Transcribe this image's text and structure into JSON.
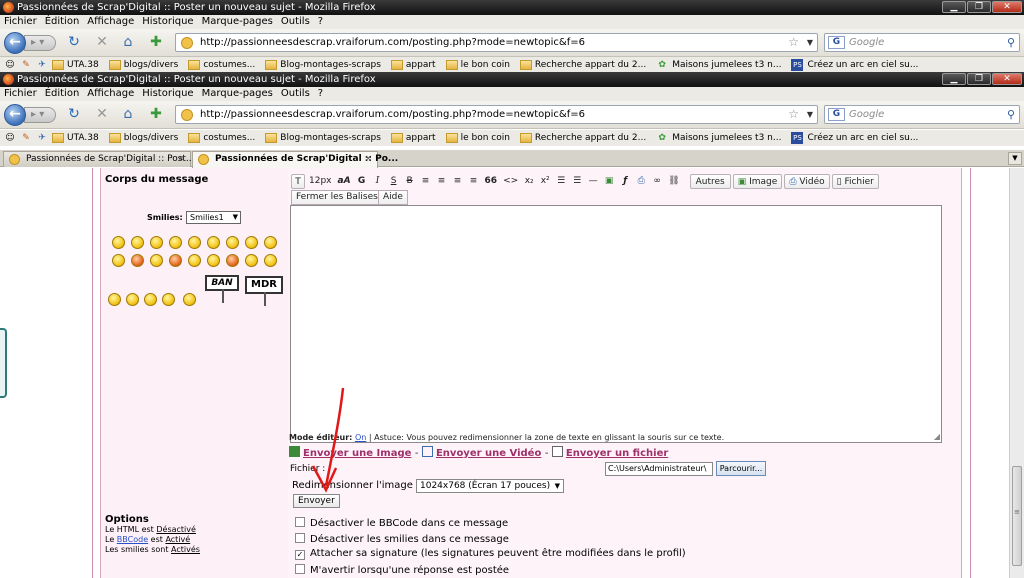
{
  "window1": {
    "title": "Passionnées de Scrap'Digital :: Poster un nouveau sujet - Mozilla Firefox"
  },
  "window2": {
    "title": "Passionnées de Scrap'Digital :: Poster un nouveau sujet - Mozilla Firefox"
  },
  "menu": [
    "Fichier",
    "Édition",
    "Affichage",
    "Historique",
    "Marque-pages",
    "Outils",
    "?"
  ],
  "url": "http://passionneesdescrap.vraiforum.com/posting.php?mode=newtopic&f=6",
  "search_placeholder": "Google",
  "search_engine_letter": "G",
  "bookmarks1": [
    "UTA.38",
    "blogs/divers",
    "costumes...",
    "Blog-montages-scraps",
    "appart",
    "le bon coin",
    "Recherche appart du 2...",
    "Maisons jumelees t3 n...",
    "Créez un arc en ciel su..."
  ],
  "bookmarks2": [
    "UTA.38",
    "blogs/divers",
    "costumes...",
    "Blog-montages-scraps",
    "appart",
    "le bon coin",
    "Recherche appart du 2...",
    "Maisons jumelees t3 n...",
    "Créez un arc en ciel su..."
  ],
  "ps_label": "PS",
  "tabs": [
    {
      "label": "Passionnées de Scrap'Digital :: Post...",
      "close": "×"
    },
    {
      "label": "Passionnées de Scrap'Digital :: Po...",
      "close": "×"
    }
  ],
  "form": {
    "body_label": "Corps du message",
    "smilies_label": "Smilies:",
    "smilies_value": "Smilies1",
    "sign_ban": "BAN",
    "sign_mdr": "MDR",
    "toolbar": {
      "font_size": "12px",
      "aA": "aA",
      "bold": "G",
      "italic": "I",
      "underline": "S",
      "strike": "B",
      "quote": "66",
      "code": "<>",
      "sub": "x₂",
      "sup": "x²",
      "autres": "Autres",
      "image": "Image",
      "video": "Vidéo",
      "fichier": "Fichier",
      "close_tags": "Fermer les Balises",
      "aide": "Aide"
    },
    "editor_mode_label": "Mode éditeur:",
    "editor_mode_value": "On",
    "tip": "| Astuce: Vous pouvez redimensionner la zone de texte en glissant la souris sur ce texte.",
    "send_image": "Envoyer une Image",
    "send_video": "Envoyer une Vidéo",
    "send_file": "Envoyer un fichier",
    "file_label": "Fichier :",
    "file_path": "C:\\Users\\Administrateur\\",
    "browse": "Parcourir...",
    "resize_label": "Redimensionner l'image ?",
    "resize_value": "1024x768 (Écran 17 pouces)",
    "send_button": "Envoyer"
  },
  "options": {
    "heading": "Options",
    "html_text": "Le HTML est",
    "html_value": "Désactivé",
    "bbcode_pre": "Le",
    "bbcode_link": "BBCode",
    "bbcode_mid": "est",
    "bbcode_value": "Activé",
    "smilies_text": "Les smilies sont",
    "smilies_value": "Activés",
    "checkboxes": [
      {
        "label": "Désactiver le BBCode dans ce message",
        "checked": false
      },
      {
        "label": "Désactiver les smilies dans ce message",
        "checked": false
      },
      {
        "label": "Attacher sa signature (les signatures peuvent être modifiées dans le profil)",
        "checked": true
      },
      {
        "label": "M'avertir lorsqu'une réponse est postée",
        "checked": false
      }
    ]
  },
  "colors": {
    "accent_link": "#a0306a",
    "frame_border": "#ca8fb0",
    "panel_bg": "#fdf3f8"
  }
}
